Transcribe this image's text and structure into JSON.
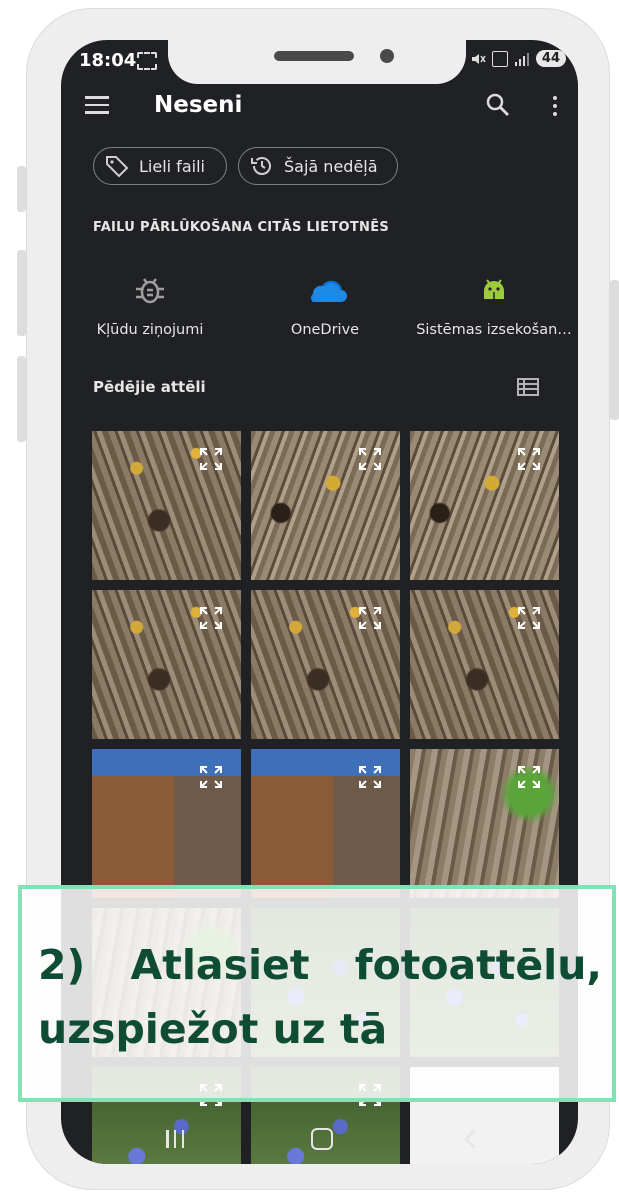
{
  "status": {
    "time": "18:04",
    "battery": "44"
  },
  "appbar": {
    "title": "Neseni"
  },
  "chips": [
    {
      "label": "Lieli faili",
      "icon": "tag-icon"
    },
    {
      "label": "Šajā nedēļā",
      "icon": "history-icon"
    }
  ],
  "browse_section": {
    "label": "FAILU PĀRLŪKOŠANA CITĀS LIETOTNĒS",
    "apps": [
      {
        "label": "Kļūdu ziņojumi",
        "icon": "bug-icon"
      },
      {
        "label": "OneDrive",
        "icon": "onedrive-icon"
      },
      {
        "label": "Sistēmas izsekošan…",
        "icon": "android-icon"
      }
    ]
  },
  "recent_images": {
    "label": "Pēdējie attēli",
    "thumbnails": [
      {
        "icon": "expand-icon"
      },
      {
        "icon": "expand-icon"
      },
      {
        "icon": "expand-icon"
      },
      {
        "icon": "expand-icon"
      },
      {
        "icon": "expand-icon"
      },
      {
        "icon": "expand-icon"
      },
      {
        "icon": "expand-icon"
      },
      {
        "icon": "expand-icon"
      },
      {
        "icon": "expand-icon"
      },
      {
        "icon": "expand-icon"
      },
      {
        "icon": "expand-icon"
      },
      {
        "icon": "expand-icon"
      },
      {
        "icon": "expand-icon"
      },
      {
        "icon": "expand-icon"
      },
      {
        "icon": "expand-icon"
      }
    ]
  },
  "instruction": {
    "line1_words": [
      "2)",
      "Atlasiet",
      "fotoattēlu,"
    ],
    "line2": "uzspiežot uz tā",
    "text_color": "#0e4d34",
    "border_color": "#83e2b3"
  },
  "colors": {
    "screen_bg": "#202124",
    "onedrive_blue": "#1e88e5",
    "android_green": "#9ccc3c"
  }
}
